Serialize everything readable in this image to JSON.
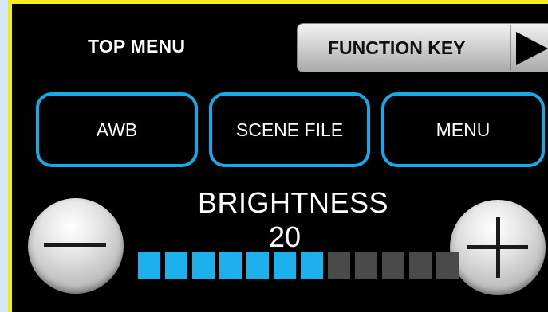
{
  "header": {
    "title": "TOP MENU",
    "function_key_label": "FUNCTION KEY"
  },
  "menu_buttons": [
    {
      "label": "AWB"
    },
    {
      "label": "SCENE FILE"
    },
    {
      "label": "MENU"
    }
  ],
  "brightness": {
    "label": "BRIGHTNESS",
    "value": "20",
    "level_segments_filled": 7,
    "level_segments_total": 12
  },
  "icons": {
    "decrease": "minus-icon",
    "increase": "plus-icon",
    "function_key_arrow": "play-arrow-icon"
  },
  "colors": {
    "accent": "#18a9e6",
    "segment_on": "#1cb0ec",
    "segment_off": "#4a4a4a",
    "frame_border": "#f2ec1c",
    "screen_background": "#000000"
  }
}
